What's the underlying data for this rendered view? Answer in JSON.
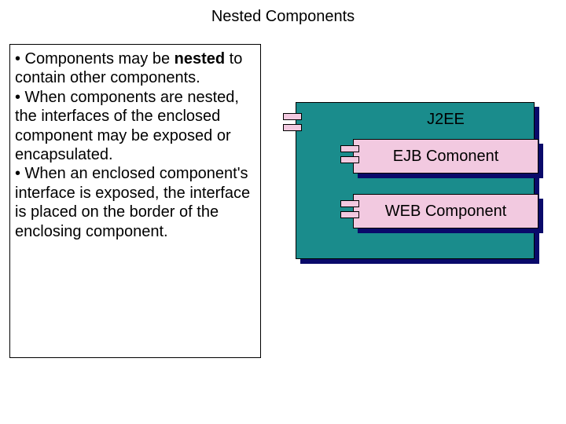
{
  "title": "Nested Components",
  "text": {
    "p1_pre": "• Components may be ",
    "p1_bold": "nested",
    "p1_post": " to contain other components.",
    "p2": "• When components are nested, the interfaces of the enclosed component may be exposed or encapsulated.",
    "p3": "• When an enclosed component's interface is exposed, the interface is placed on the border of the enclosing component."
  },
  "diagram": {
    "outer_label": "J2EE",
    "ejb_label": "EJB Comonent",
    "web_label": "WEB Component"
  }
}
